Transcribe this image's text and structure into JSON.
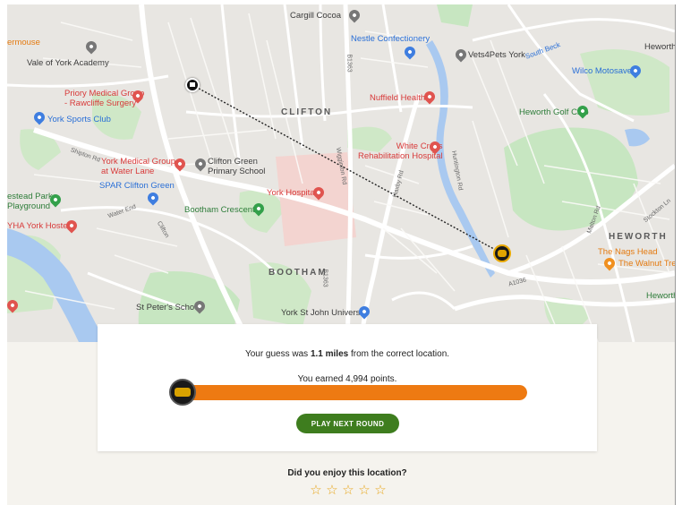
{
  "map": {
    "labels": {
      "cargill": "Cargill Cocoa",
      "nestle": "Nestle Confectionery",
      "vets": "Vets4Pets York",
      "heworth_top": "Heworth",
      "vale": "Vale of York Academy",
      "wilco": "Wilco Motosave",
      "priory": "Priory Medical Group\n- Rawcliffe Surgery",
      "nuffield": "Nuffield Health",
      "clifton": "CLIFTON",
      "york_sports": "York Sports Club",
      "heworth_golf": "Heworth Golf Club",
      "white_cross": "White Cross\nRehabilitation Hospital",
      "york_medical": "York Medical Group\nat Water Lane",
      "clifton_green_school": "Clifton Green\nPrimary School",
      "spar": "SPAR Clifton Green",
      "york_hospital": "York Hospital",
      "bootham_crescent": "Bootham Crescent",
      "stead_park": "estead Park\nPlayground",
      "yha": "YHA York Hostel",
      "heworth": "HEWORTH",
      "nags_head": "The Nags Head",
      "walnut_tree": "The Walnut Tree",
      "bootham": "BOOTHAM",
      "st_peters": "St Peter's School",
      "york_st_john": "York St John University",
      "heworth_h": "Heworth H",
      "ermouse": "ermouse",
      "south_beck": "South Beck",
      "road_b1363": "B1363",
      "road_a1036": "A1036",
      "road_shipton": "Shipton Rd",
      "road_water_end": "Water End",
      "road_clifton": "Clifton",
      "road_wigginton": "Wigginton Rd",
      "road_huntington": "Huntington Rd",
      "road_stockton": "Stockton Ln",
      "road_malton": "Malton Rd",
      "road_haxby": "Haxby Rd"
    },
    "icons": {
      "guess": "flag-icon",
      "actual": "location-badge-icon"
    }
  },
  "result": {
    "guess_prefix": "Your guess was ",
    "distance": "1.1 miles",
    "guess_suffix": " from the correct location.",
    "points_text": "You earned 4,994 points.",
    "points": 4994,
    "max_points": 5000,
    "progress_fraction": 0.9988,
    "next_button": "PLAY NEXT ROUND"
  },
  "rating": {
    "question": "Did you enjoy this location?",
    "stars": [
      "☆",
      "☆",
      "☆",
      "☆",
      "☆"
    ],
    "max_stars": 5
  },
  "colors": {
    "progress_fill": "#ee7a12",
    "button": "#3e7d1e",
    "star": "#e8a61a"
  }
}
